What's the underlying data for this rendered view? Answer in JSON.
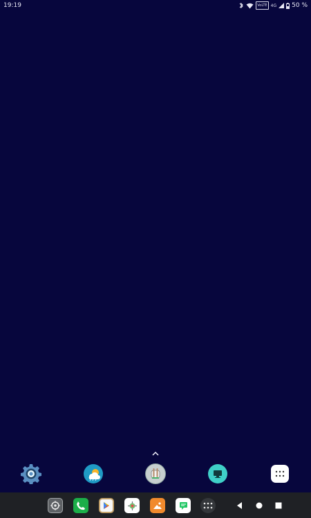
{
  "status_bar": {
    "time": "19:19",
    "network_label": "4G",
    "volte_label": "VoLTE",
    "battery_percent": "50 %",
    "icons": [
      "bluetooth-icon",
      "wifi-icon",
      "volte-icon",
      "signal-icon",
      "battery-icon"
    ]
  },
  "home_screen": {
    "swipe_indicator_icon": "chevron-up-icon",
    "dock_apps": [
      {
        "name": "settings",
        "icon": "gear-icon"
      },
      {
        "name": "weather",
        "icon": "weather-icon"
      },
      {
        "name": "android-app",
        "icon": "android-icon"
      },
      {
        "name": "remote-desktop",
        "icon": "monitor-icon"
      },
      {
        "name": "app-drawer",
        "icon": "apps-grid-icon"
      }
    ]
  },
  "taskbar": {
    "apps": [
      {
        "name": "settings-shortcut",
        "icon": "gear-icon"
      },
      {
        "name": "phone",
        "icon": "phone-icon"
      },
      {
        "name": "play-store",
        "icon": "play-store-icon"
      },
      {
        "name": "android-tools",
        "icon": "android-tools-icon"
      },
      {
        "name": "gallery",
        "icon": "image-icon"
      },
      {
        "name": "messages",
        "icon": "message-icon"
      },
      {
        "name": "all-apps",
        "icon": "grid-icon"
      }
    ],
    "navigation": [
      "back-icon",
      "home-icon",
      "recents-icon"
    ]
  },
  "colors": {
    "wallpaper": "#07063d",
    "taskbar": "#1f2125",
    "accent_teal": "#3fd0c8",
    "accent_orange": "#f18a2d"
  }
}
